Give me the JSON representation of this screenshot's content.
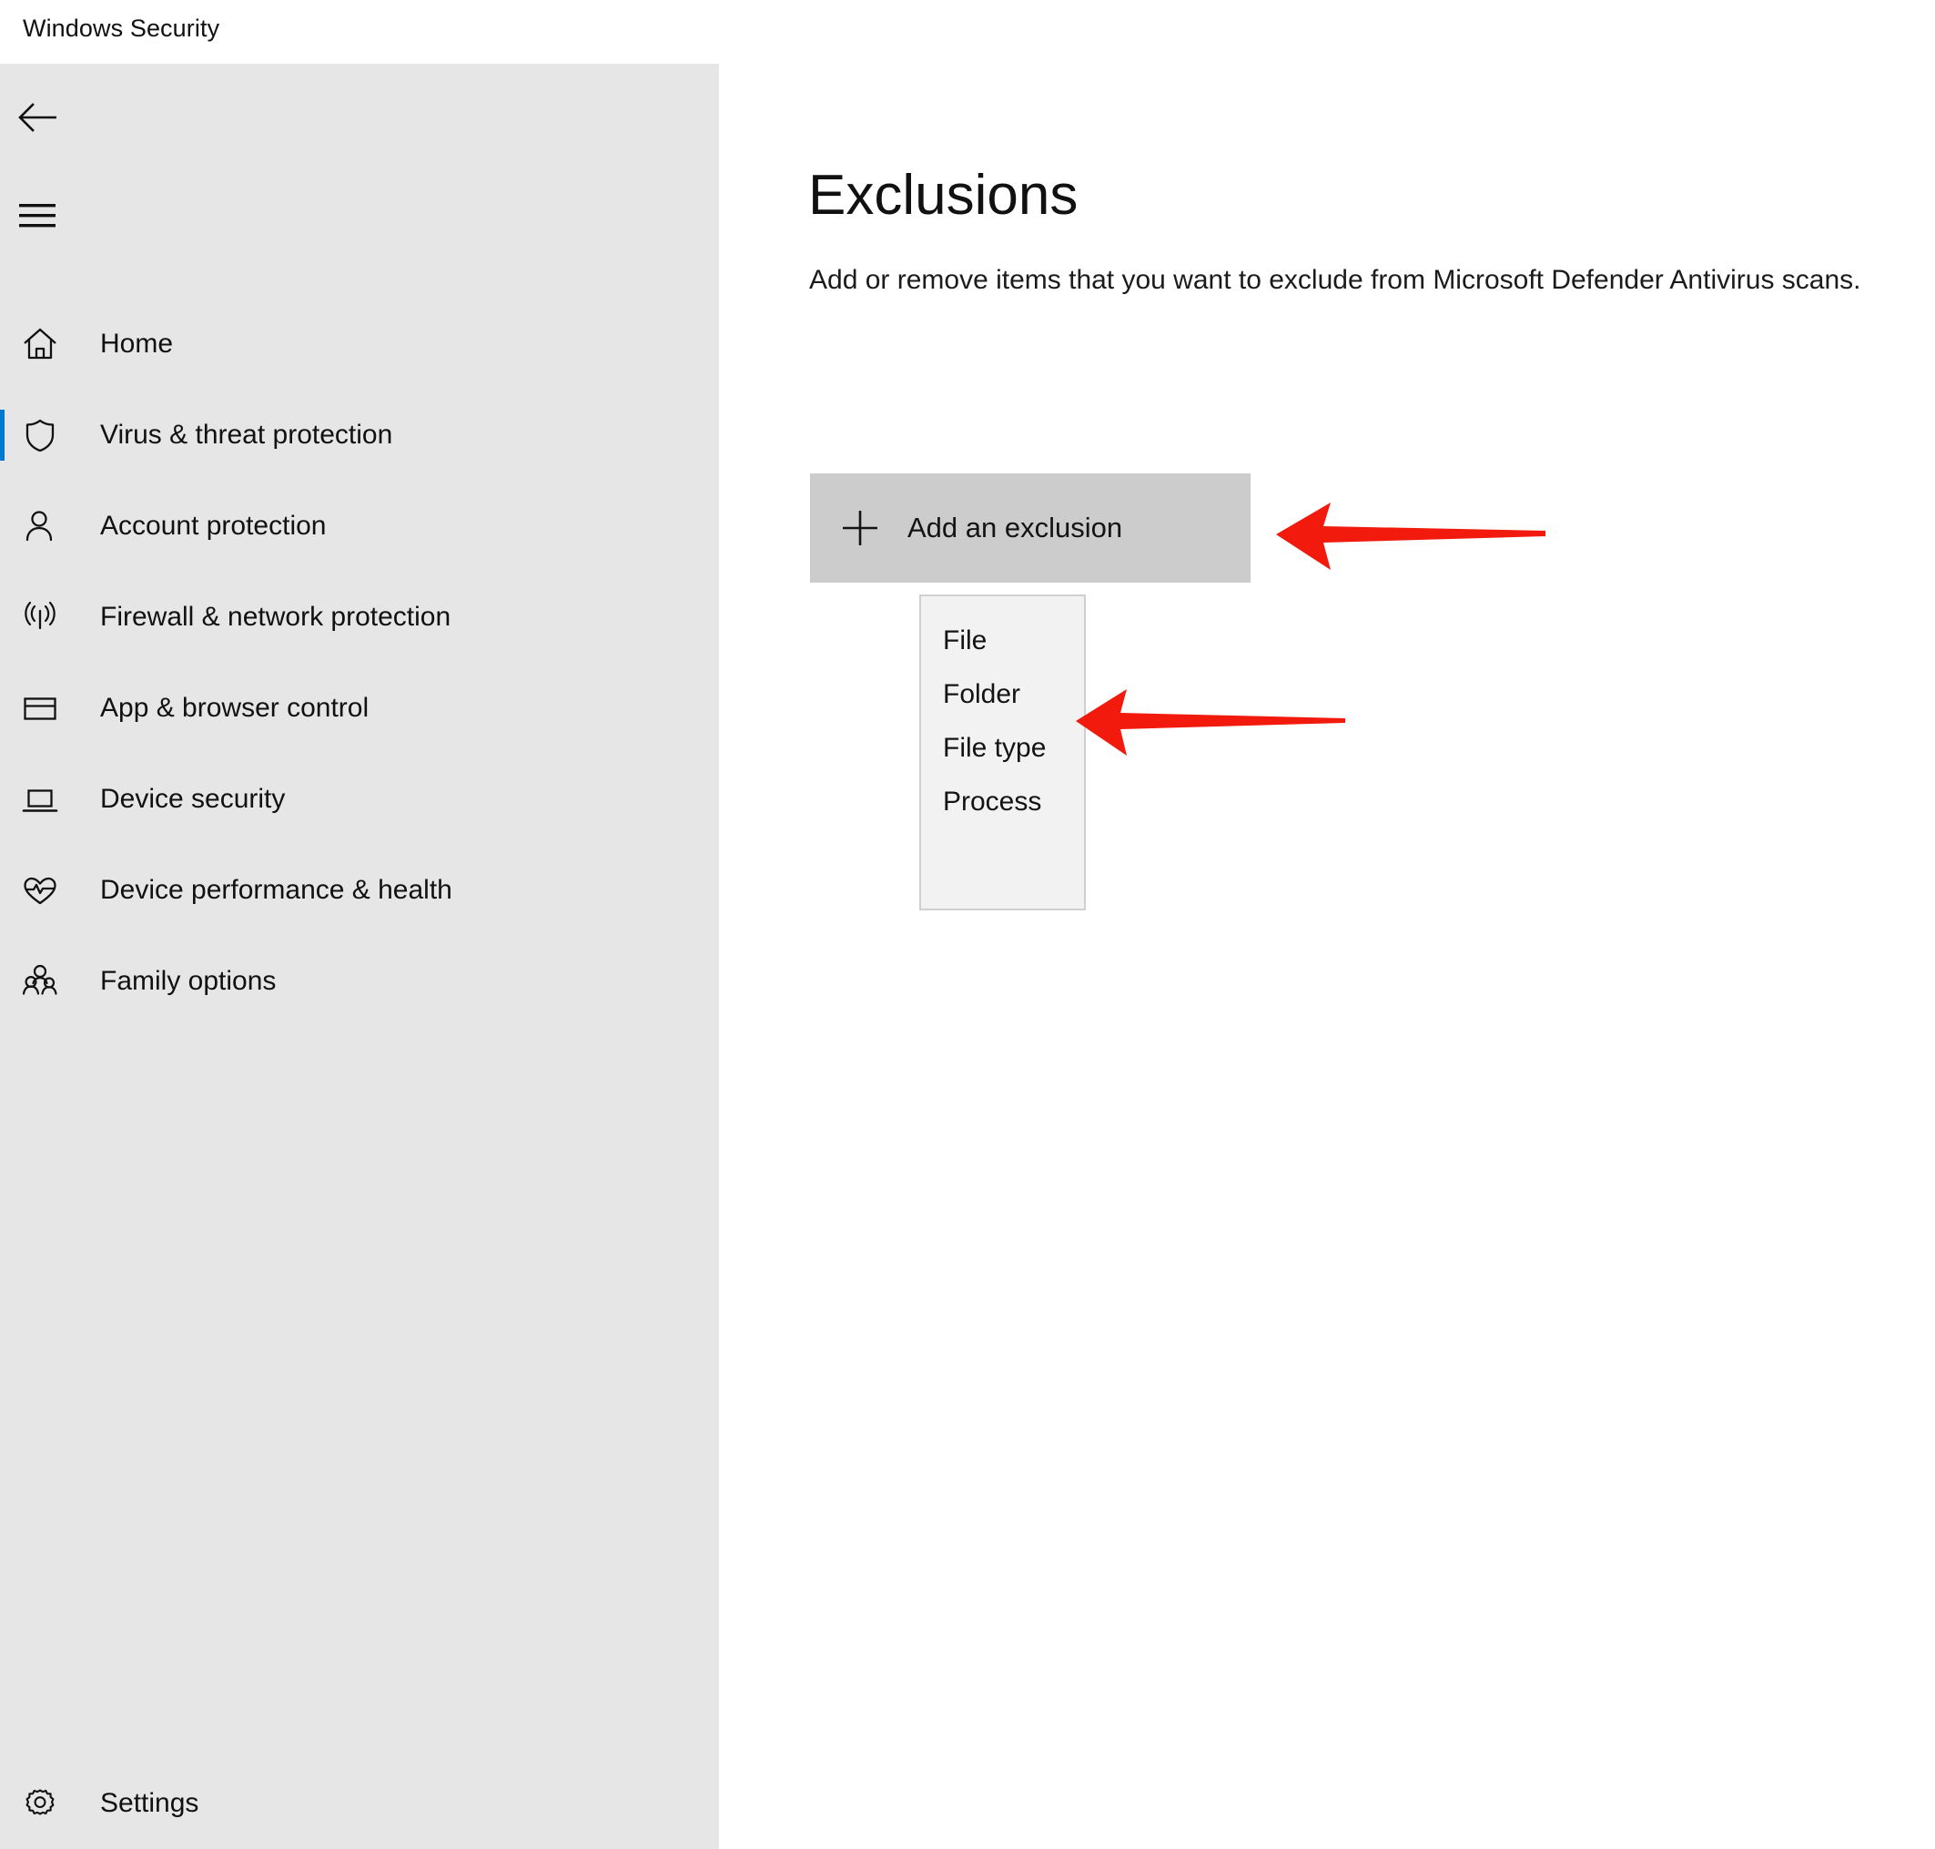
{
  "window": {
    "title": "Windows Security"
  },
  "sidebar": {
    "back_icon": "back-arrow-icon",
    "menu_icon": "hamburger-menu-icon",
    "items": [
      {
        "label": "Home",
        "icon": "home-icon",
        "selected": false
      },
      {
        "label": "Virus & threat protection",
        "icon": "shield-icon",
        "selected": true
      },
      {
        "label": "Account protection",
        "icon": "person-icon",
        "selected": false
      },
      {
        "label": "Firewall & network protection",
        "icon": "wifi-signal-icon",
        "selected": false
      },
      {
        "label": "App & browser control",
        "icon": "window-icon",
        "selected": false
      },
      {
        "label": "Device security",
        "icon": "laptop-icon",
        "selected": false
      },
      {
        "label": "Device performance & health",
        "icon": "heartbeat-icon",
        "selected": false
      },
      {
        "label": "Family options",
        "icon": "people-group-icon",
        "selected": false
      }
    ],
    "settings": {
      "label": "Settings",
      "icon": "gear-icon"
    },
    "accent_color": "#0078d4",
    "background_color": "#e6e6e6"
  },
  "main": {
    "title": "Exclusions",
    "description": "Add or remove items that you want to exclude from Microsoft Defender Antivirus scans.",
    "add_button": {
      "label": "Add an exclusion",
      "icon": "plus-icon",
      "background_color": "#cccccc"
    },
    "menu": {
      "items": [
        "File",
        "Folder",
        "File type",
        "Process"
      ],
      "background_color": "#f2f2f2",
      "border_color": "#cfcfcf"
    }
  },
  "annotations": {
    "color": "#f21a0d",
    "arrows": [
      {
        "name": "arrow-add-exclusion",
        "points_to": "Add an exclusion"
      },
      {
        "name": "arrow-folder",
        "points_to": "Folder"
      }
    ]
  }
}
